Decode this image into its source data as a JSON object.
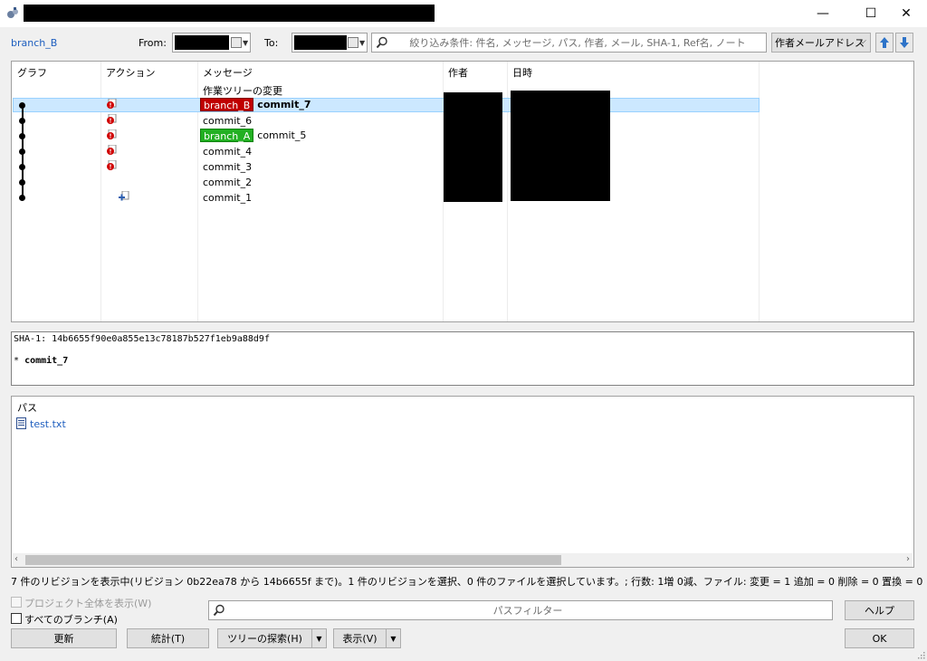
{
  "window": {
    "minimize": "—",
    "maximize": "☐",
    "close": "✕"
  },
  "toolbar": {
    "branch": "branch_B",
    "from_label": "From:",
    "to_label": "To:",
    "search_placeholder": "絞り込み条件: 件名, メッセージ, パス, 作者, メール, SHA-1, Ref名, ノート",
    "filter_select": "作者メールアドレス"
  },
  "log": {
    "columns": [
      "グラフ",
      "アクション",
      "メッセージ",
      "作者",
      "日時"
    ],
    "rows": [
      {
        "message": "作業ツリーの変更",
        "ref": null
      },
      {
        "message": "commit_7",
        "ref": "branch_B",
        "selected": true
      },
      {
        "message": "commit_6",
        "ref": null
      },
      {
        "message": "commit_5",
        "ref": "branch_A"
      },
      {
        "message": "commit_4",
        "ref": null
      },
      {
        "message": "commit_3",
        "ref": null
      },
      {
        "message": "commit_2",
        "ref": null
      },
      {
        "message": "commit_1",
        "ref": null
      }
    ]
  },
  "detail": {
    "sha": "SHA-1: 14b6655f90e0a855e13c78187b527f1eb9a88d9f",
    "bullet": "*",
    "subject": "commit_7"
  },
  "files": {
    "header": "パス",
    "items": [
      "test.txt"
    ]
  },
  "status": "7 件のリビジョンを表示中(リビジョン 0b22ea78 から 14b6655f まで)。1 件のリビジョンを選択、0 件のファイルを選択しています。; 行数: 1増 0減、ファイル: 変更 = 1 追加 = 0 削除 = 0 置換 = 0",
  "bottom": {
    "show_whole_project": "プロジェクト全体を表示(W)",
    "all_branches": "すべてのブランチ(A)",
    "path_filter_placeholder": "パスフィルター",
    "help": "ヘルプ",
    "refresh": "更新",
    "stats": "統計(T)",
    "tree_explore": "ツリーの探索(H)",
    "view": "表示(V)",
    "ok": "OK"
  },
  "colors": {
    "branch_b": "#c00000",
    "branch_a": "#22b022",
    "selection": "#cce8ff",
    "link": "#1f5fbf"
  }
}
